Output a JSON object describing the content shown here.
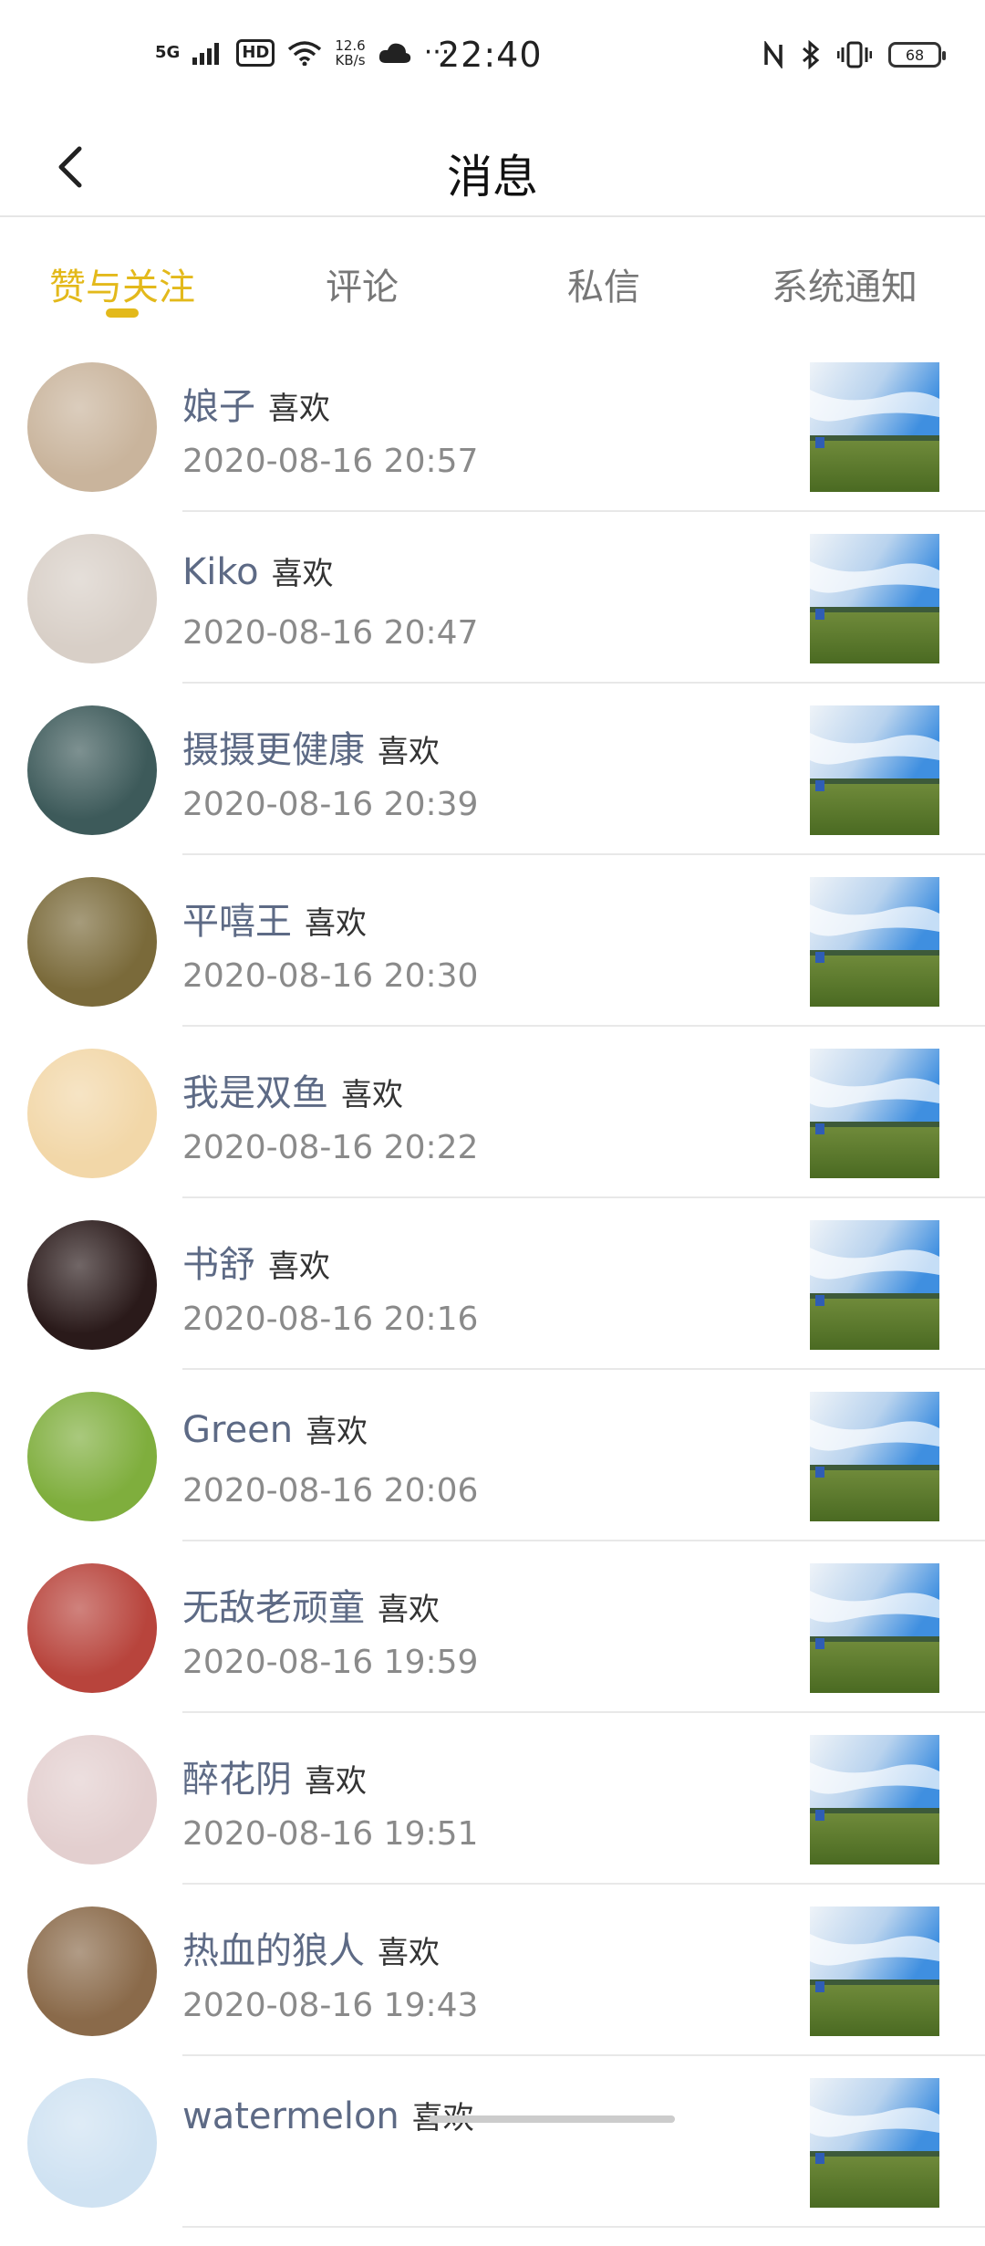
{
  "status_bar": {
    "network": "5G",
    "hd": "HD",
    "speed_value": "12.6",
    "speed_unit": "KB/s",
    "more": "···",
    "time": "22:40",
    "battery": "68"
  },
  "header": {
    "title": "消息"
  },
  "tabs": [
    {
      "label": "赞与关注"
    },
    {
      "label": "评论"
    },
    {
      "label": "私信"
    },
    {
      "label": "系统通知"
    }
  ],
  "notifications": [
    {
      "name": "娘子",
      "action": "喜欢",
      "time": "2020-08-16 20:57",
      "avatar_color": "#c9b49c"
    },
    {
      "name": "Kiko",
      "action": "喜欢",
      "time": "2020-08-16 20:47",
      "avatar_color": "#d8cfc7"
    },
    {
      "name": "摄摄更健康",
      "action": "喜欢",
      "time": "2020-08-16 20:39",
      "avatar_color": "#3d5a5a"
    },
    {
      "name": "平嘻王",
      "action": "喜欢",
      "time": "2020-08-16 20:30",
      "avatar_color": "#7a6a3a"
    },
    {
      "name": "我是双鱼",
      "action": "喜欢",
      "time": "2020-08-16 20:22",
      "avatar_color": "#f2d7a8"
    },
    {
      "name": "书舒",
      "action": "喜欢",
      "time": "2020-08-16 20:16",
      "avatar_color": "#2a1a1a"
    },
    {
      "name": "Green",
      "action": "喜欢",
      "time": "2020-08-16 20:06",
      "avatar_color": "#7fae3d"
    },
    {
      "name": "无敌老顽童",
      "action": "喜欢",
      "time": "2020-08-16 19:59",
      "avatar_color": "#b8443c"
    },
    {
      "name": "醉花阴",
      "action": "喜欢",
      "time": "2020-08-16 19:51",
      "avatar_color": "#e3cfcf"
    },
    {
      "name": "热血的狼人",
      "action": "喜欢",
      "time": "2020-08-16 19:43",
      "avatar_color": "#8a6a4a"
    },
    {
      "name": "watermelon",
      "action": "喜欢",
      "time": "",
      "avatar_color": "#cfe2f2"
    }
  ],
  "colors": {
    "accent": "#e3b91b",
    "name_color": "#5d6a85"
  }
}
